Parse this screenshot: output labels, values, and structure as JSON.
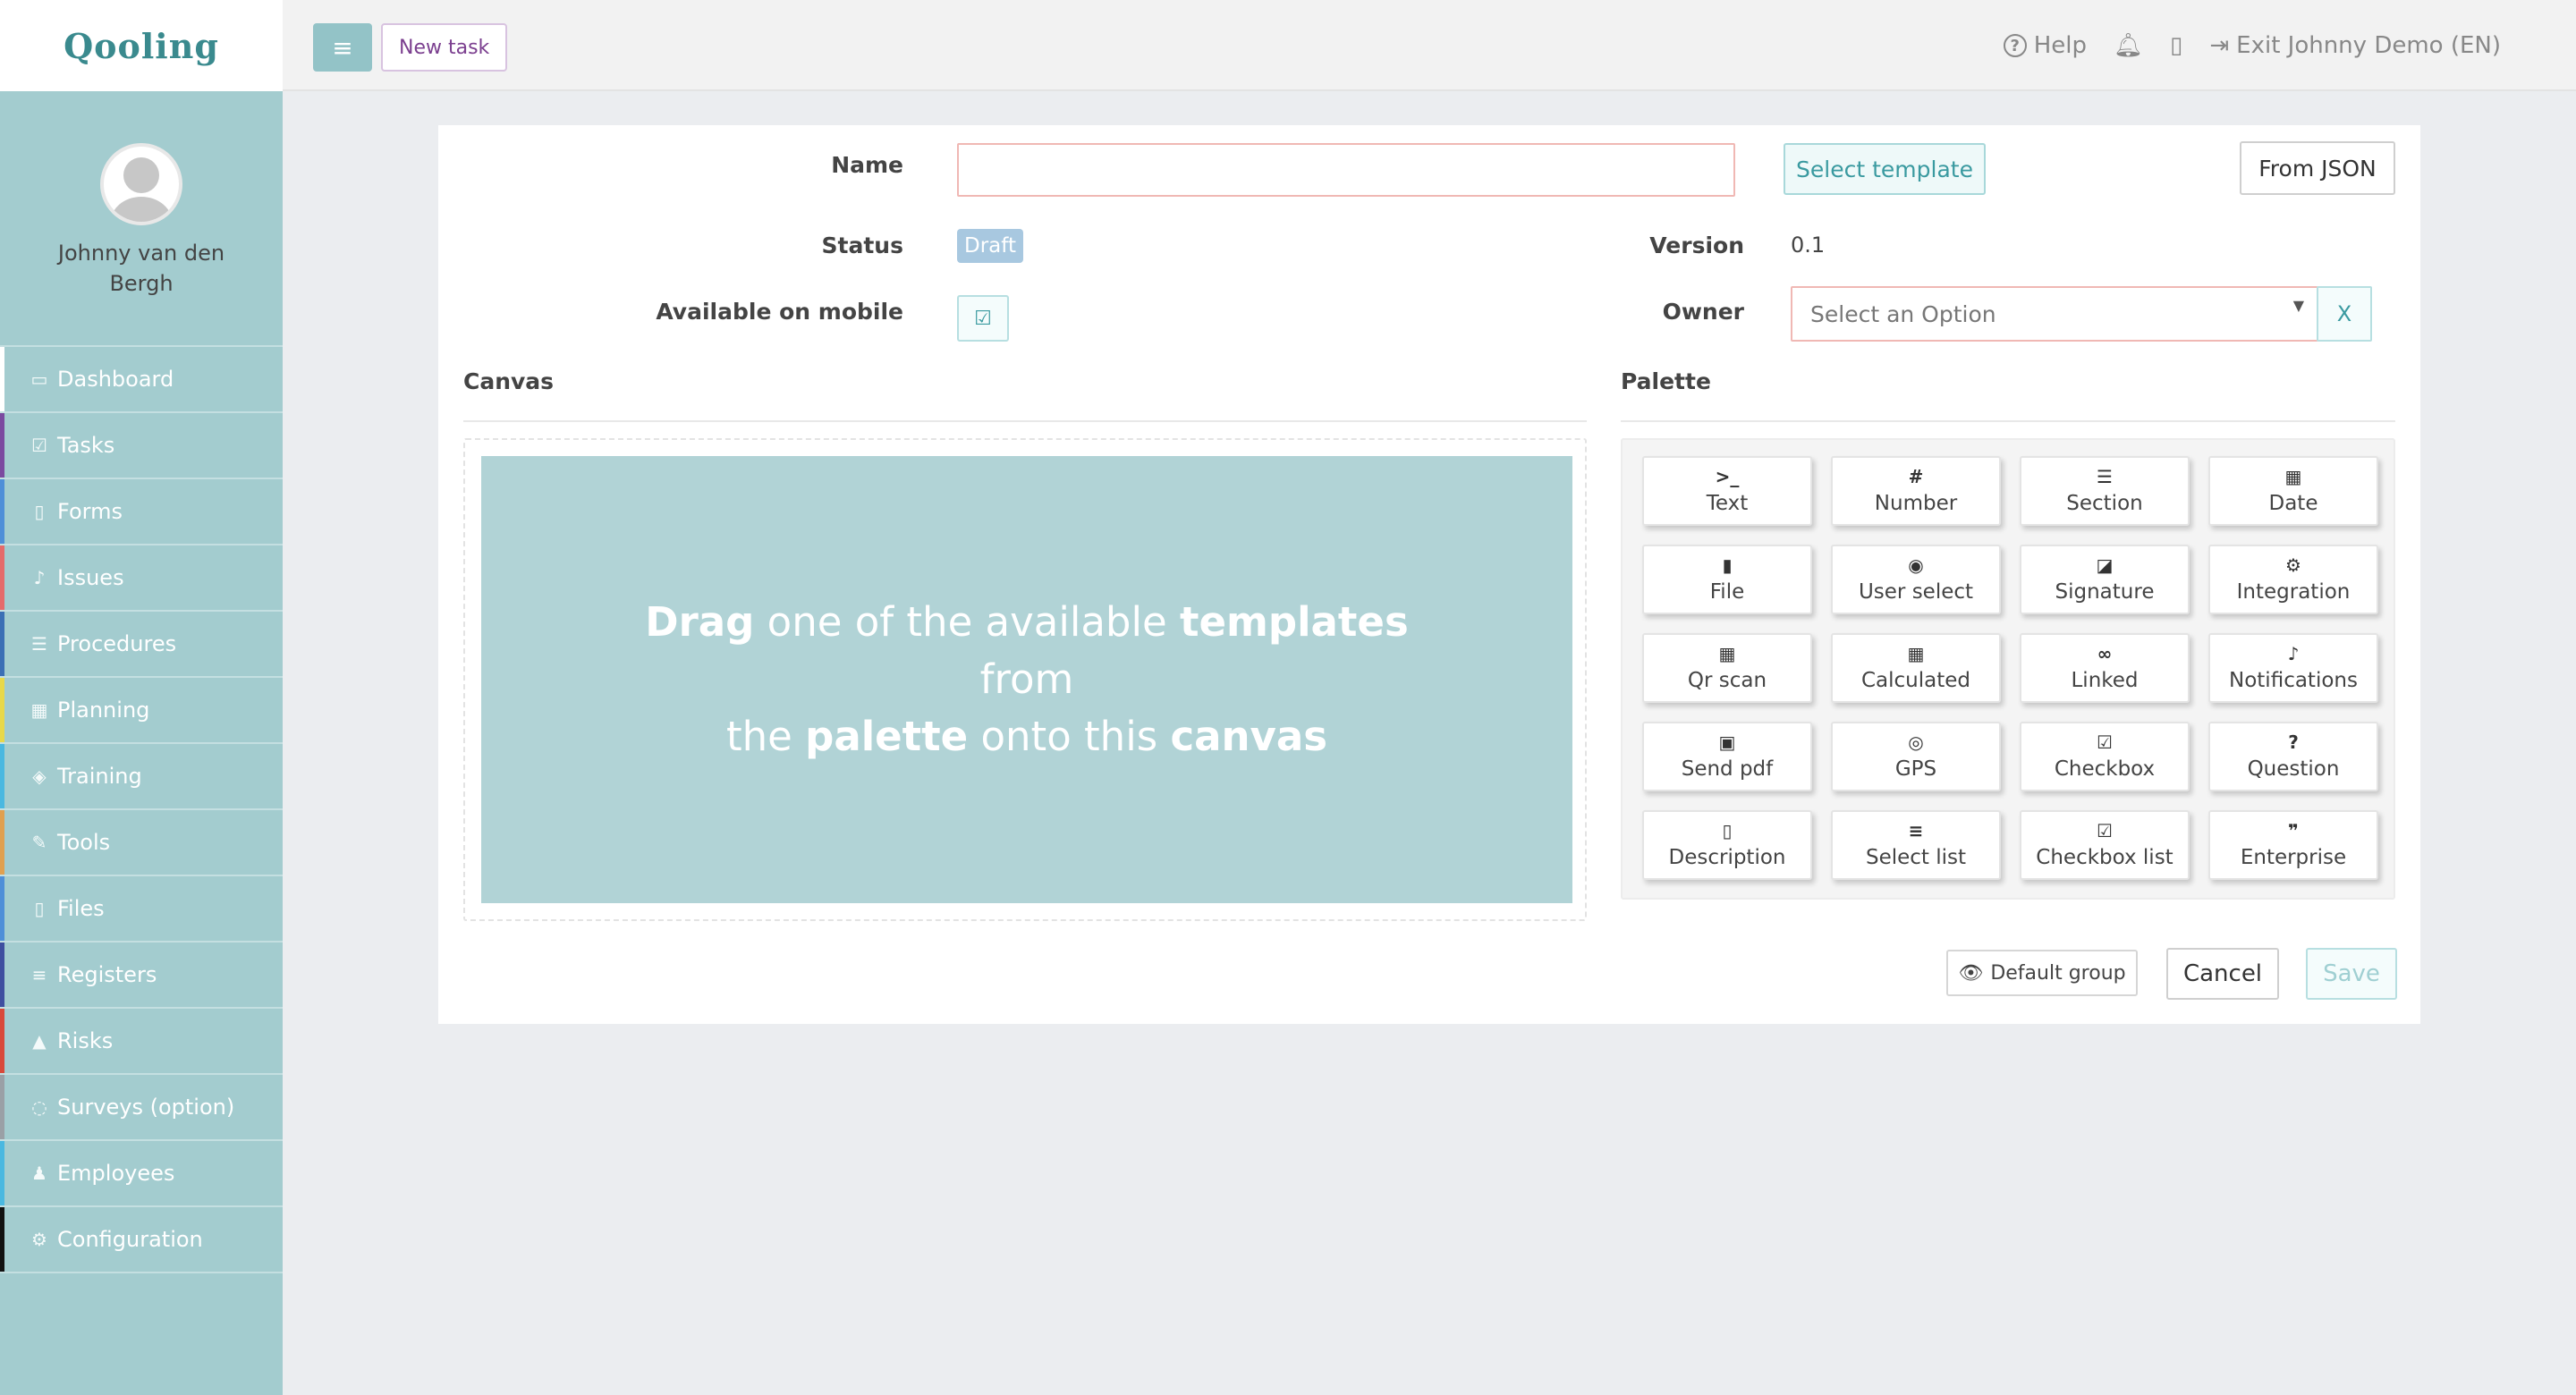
{
  "brand": {
    "logo_text": "Qooling"
  },
  "user": {
    "name": "Johnny van den Bergh"
  },
  "nav": [
    {
      "label": "Dashboard",
      "icon": "monitor-icon",
      "glyph": "▭",
      "color": "#ffffff"
    },
    {
      "label": "Tasks",
      "icon": "check-square-icon",
      "glyph": "☑",
      "color": "#7b4aa0"
    },
    {
      "label": "Forms",
      "icon": "file-icon",
      "glyph": "▯",
      "color": "#4f8fd8"
    },
    {
      "label": "Issues",
      "icon": "bell-icon",
      "glyph": "♪",
      "color": "#e56b6b"
    },
    {
      "label": "Procedures",
      "icon": "list-alt-icon",
      "glyph": "☰",
      "color": "#3b6fb5"
    },
    {
      "label": "Planning",
      "icon": "calendar-icon",
      "glyph": "▦",
      "color": "#e8d84a"
    },
    {
      "label": "Training",
      "icon": "graduation-cap-icon",
      "glyph": "◈",
      "color": "#4ab8e0"
    },
    {
      "label": "Tools",
      "icon": "wrench-icon",
      "glyph": "✎",
      "color": "#e0a050"
    },
    {
      "label": "Files",
      "icon": "file-pdf-icon",
      "glyph": "▯",
      "color": "#4f8fd8"
    },
    {
      "label": "Registers",
      "icon": "list-icon",
      "glyph": "≡",
      "color": "#3f4fa0"
    },
    {
      "label": "Risks",
      "icon": "warning-icon",
      "glyph": "▲",
      "color": "#d84a3a"
    },
    {
      "label": "Surveys (option)",
      "icon": "comments-icon",
      "glyph": "◌",
      "color": "#9aa0a6"
    },
    {
      "label": "Employees",
      "icon": "users-icon",
      "glyph": "♟",
      "color": "#4ab8e0"
    },
    {
      "label": "Configuration",
      "icon": "gear-icon",
      "glyph": "⚙",
      "color": "#111111"
    }
  ],
  "topbar": {
    "menu_glyph": "≡",
    "new_task": "New task",
    "help": "Help",
    "exit": "Exit Johnny Demo (EN)"
  },
  "form": {
    "name_label": "Name",
    "name_value": "",
    "select_template": "Select template",
    "from_json": "From JSON",
    "status_label": "Status",
    "status_value": "Draft",
    "version_label": "Version",
    "version_value": "0.1",
    "mobile_label": "Available on mobile",
    "owner_label": "Owner",
    "owner_placeholder": "Select an Option",
    "owner_clear": "X"
  },
  "canvas": {
    "title": "Canvas",
    "drop_w1": "Drag",
    "drop_t1": " one of the available ",
    "drop_w2": "templates",
    "drop_t2": "from",
    "drop_t3": "the ",
    "drop_w3": "palette",
    "drop_t4": " onto this ",
    "drop_w4": "canvas"
  },
  "palette": {
    "title": "Palette",
    "items": [
      {
        "label": "Text",
        "icon": "terminal-icon",
        "glyph": ">_"
      },
      {
        "label": "Number",
        "icon": "hashtag-icon",
        "glyph": "#"
      },
      {
        "label": "Section",
        "icon": "list-alt-icon",
        "glyph": "☰"
      },
      {
        "label": "Date",
        "icon": "calendar-icon",
        "glyph": "▦"
      },
      {
        "label": "File",
        "icon": "file-icon",
        "glyph": "▮"
      },
      {
        "label": "User select",
        "icon": "user-circle-icon",
        "glyph": "◉"
      },
      {
        "label": "Signature",
        "icon": "pen-square-icon",
        "glyph": "◪"
      },
      {
        "label": "Integration",
        "icon": "cogs-icon",
        "glyph": "⚙"
      },
      {
        "label": "Qr scan",
        "icon": "qrcode-icon",
        "glyph": "▦"
      },
      {
        "label": "Calculated",
        "icon": "calculator-icon",
        "glyph": "▦"
      },
      {
        "label": "Linked",
        "icon": "link-icon",
        "glyph": "∞"
      },
      {
        "label": "Notifications",
        "icon": "bell-icon",
        "glyph": "♪"
      },
      {
        "label": "Send pdf",
        "icon": "file-pdf-icon",
        "glyph": "▣"
      },
      {
        "label": "GPS",
        "icon": "crosshair-icon",
        "glyph": "◎"
      },
      {
        "label": "Checkbox",
        "icon": "check-square-icon",
        "glyph": "☑"
      },
      {
        "label": "Question",
        "icon": "question-circle-icon",
        "glyph": "?"
      },
      {
        "label": "Description",
        "icon": "file-text-icon",
        "glyph": "▯"
      },
      {
        "label": "Select list",
        "icon": "list-ol-icon",
        "glyph": "≡"
      },
      {
        "label": "Checkbox list",
        "icon": "check-square-icon",
        "glyph": "☑"
      },
      {
        "label": "Enterprise",
        "icon": "quote-icon",
        "glyph": "❞"
      }
    ]
  },
  "footer": {
    "default_group": "Default group",
    "cancel": "Cancel",
    "save": "Save"
  }
}
